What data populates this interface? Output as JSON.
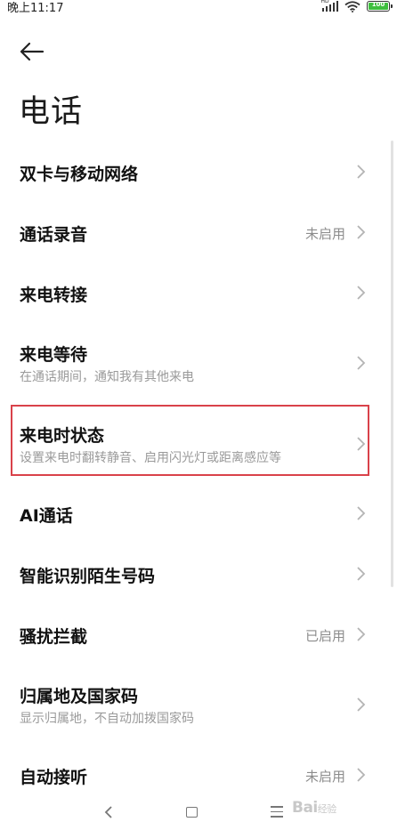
{
  "status_bar": {
    "time": "晚上11:17",
    "network_tag": "HD",
    "battery": "100",
    "battery_color": "#3fbf3f"
  },
  "header": {
    "back_icon": "arrow-left-icon",
    "title": "电话"
  },
  "settings": [
    {
      "title": "双卡与移动网络",
      "subtitle": "",
      "value": ""
    },
    {
      "title": "通话录音",
      "subtitle": "",
      "value": "未启用"
    },
    {
      "title": "来电转接",
      "subtitle": "",
      "value": ""
    },
    {
      "title": "来电等待",
      "subtitle": "在通话期间，通知我有其他来电",
      "value": ""
    },
    {
      "title": "来电时状态",
      "subtitle": "设置来电时翻转静音、启用闪光灯或距离感应等",
      "value": "",
      "highlighted": true
    },
    {
      "title": "AI通话",
      "subtitle": "",
      "value": ""
    },
    {
      "title": "智能识别陌生号码",
      "subtitle": "",
      "value": ""
    },
    {
      "title": "骚扰拦截",
      "subtitle": "",
      "value": "已启用"
    },
    {
      "title": "归属地及国家码",
      "subtitle": "显示归属地，不自动加拨国家码",
      "value": ""
    },
    {
      "title": "自动接听",
      "subtitle": "",
      "value": "未启用"
    }
  ],
  "highlight_color": "#d9424a",
  "navbar": {
    "back_icon": "nav-back-icon",
    "home_icon": "nav-home-icon",
    "menu_icon": "nav-menu-icon",
    "watermark": "Bai",
    "watermark_sub": "经验"
  }
}
